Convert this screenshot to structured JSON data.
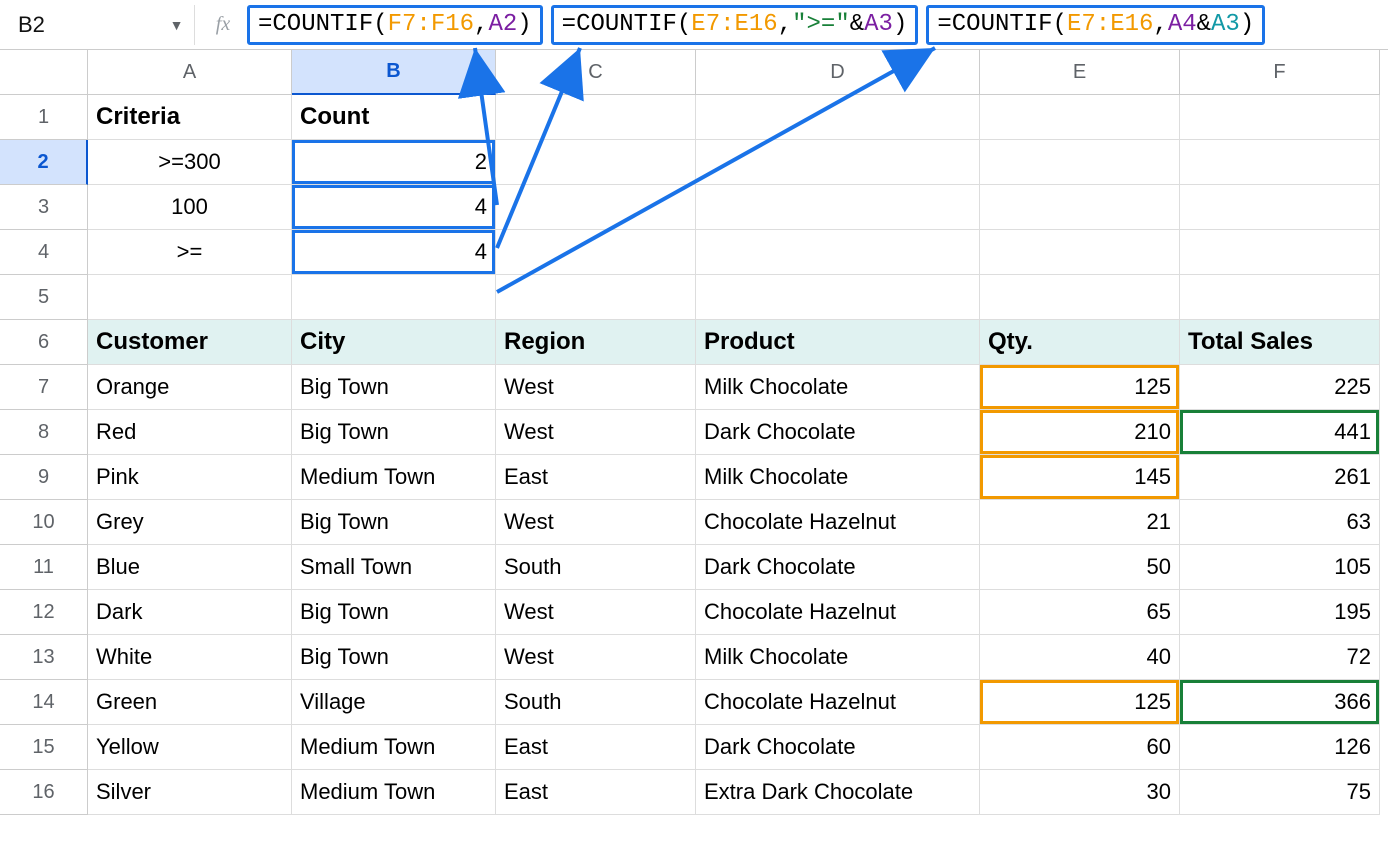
{
  "nameBox": "B2",
  "formulas": {
    "f1": {
      "pre": "=COUNTIF(",
      "r": "F7:F16",
      "mid": ",",
      "arg": "A2",
      "post": ")"
    },
    "f2": {
      "pre": "=COUNTIF(",
      "r": "E7:E16",
      "mid": ",",
      "str": "\">=\"",
      "amp": "&",
      "arg": "A3",
      "post": ")"
    },
    "f3": {
      "pre": "=COUNTIF(",
      "r": "E7:E16",
      "mid": ",",
      "a": "A4",
      "amp": "&",
      "b": "A3",
      "post": ")"
    }
  },
  "cols": {
    "A": "A",
    "B": "B",
    "C": "C",
    "D": "D",
    "E": "E",
    "F": "F"
  },
  "rows": [
    "1",
    "2",
    "3",
    "4",
    "5",
    "6",
    "7",
    "8",
    "9",
    "10",
    "11",
    "12",
    "13",
    "14",
    "15",
    "16"
  ],
  "criteriaHeader": "Criteria",
  "countHeader": "Count",
  "criteria": {
    "r2": ">=300",
    "r3": "100",
    "r4": ">="
  },
  "counts": {
    "r2": "2",
    "r3": "4",
    "r4": "4"
  },
  "tableHead": {
    "A": "Customer",
    "B": "City",
    "C": "Region",
    "D": "Product",
    "E": "Qty.",
    "F": "Total Sales"
  },
  "data": [
    {
      "cust": "Orange",
      "city": "Big Town",
      "reg": "West",
      "prod": "Milk Chocolate",
      "qty": "125",
      "tot": "225",
      "qhi": true,
      "thi": false
    },
    {
      "cust": "Red",
      "city": "Big Town",
      "reg": "West",
      "prod": "Dark Chocolate",
      "qty": "210",
      "tot": "441",
      "qhi": true,
      "thi": true
    },
    {
      "cust": "Pink",
      "city": "Medium Town",
      "reg": "East",
      "prod": "Milk Chocolate",
      "qty": "145",
      "tot": "261",
      "qhi": true,
      "thi": false
    },
    {
      "cust": "Grey",
      "city": "Big Town",
      "reg": "West",
      "prod": "Chocolate Hazelnut",
      "qty": "21",
      "tot": "63",
      "qhi": false,
      "thi": false
    },
    {
      "cust": "Blue",
      "city": "Small Town",
      "reg": "South",
      "prod": "Dark Chocolate",
      "qty": "50",
      "tot": "105",
      "qhi": false,
      "thi": false
    },
    {
      "cust": "Dark",
      "city": "Big Town",
      "reg": "West",
      "prod": "Chocolate Hazelnut",
      "qty": "65",
      "tot": "195",
      "qhi": false,
      "thi": false
    },
    {
      "cust": "White",
      "city": "Big Town",
      "reg": "West",
      "prod": "Milk Chocolate",
      "qty": "40",
      "tot": "72",
      "qhi": false,
      "thi": false
    },
    {
      "cust": "Green",
      "city": "Village",
      "reg": "South",
      "prod": "Chocolate Hazelnut",
      "qty": "125",
      "tot": "366",
      "qhi": true,
      "thi": true
    },
    {
      "cust": "Yellow",
      "city": "Medium Town",
      "reg": "East",
      "prod": "Dark Chocolate",
      "qty": "60",
      "tot": "126",
      "qhi": false,
      "thi": false
    },
    {
      "cust": "Silver",
      "city": "Medium Town",
      "reg": "East",
      "prod": "Extra Dark Chocolate",
      "qty": "30",
      "tot": "75",
      "qhi": false,
      "thi": false
    }
  ]
}
